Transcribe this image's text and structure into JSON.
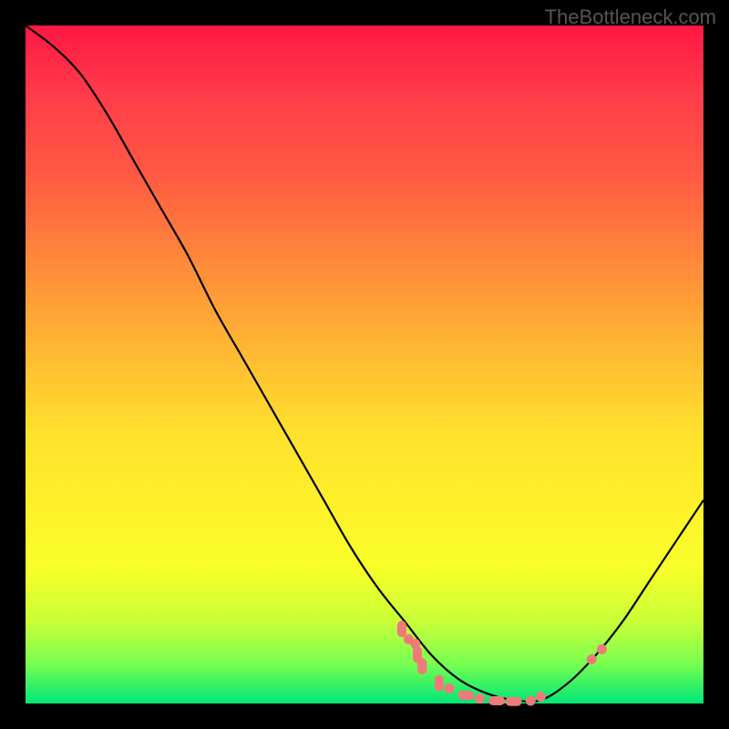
{
  "watermark": "TheBottleneck.com",
  "chart_data": {
    "type": "line",
    "title": "",
    "xlabel": "",
    "ylabel": "",
    "xlim": [
      0,
      1
    ],
    "ylim": [
      0,
      1
    ],
    "curve": {
      "name": "bottleneck-curve",
      "x": [
        0.0,
        0.04,
        0.08,
        0.12,
        0.16,
        0.2,
        0.24,
        0.28,
        0.32,
        0.36,
        0.4,
        0.44,
        0.48,
        0.52,
        0.56,
        0.6,
        0.64,
        0.68,
        0.72,
        0.76,
        0.8,
        0.84,
        0.88,
        0.92,
        0.96,
        1.0
      ],
      "y": [
        1.0,
        0.97,
        0.93,
        0.87,
        0.8,
        0.73,
        0.66,
        0.58,
        0.51,
        0.44,
        0.37,
        0.3,
        0.23,
        0.17,
        0.12,
        0.07,
        0.035,
        0.015,
        0.005,
        0.005,
        0.03,
        0.07,
        0.12,
        0.18,
        0.24,
        0.3
      ]
    },
    "highlight_points": [
      {
        "x": 0.555,
        "y": 0.11,
        "shape": "pill-v"
      },
      {
        "x": 0.565,
        "y": 0.095,
        "shape": "dot"
      },
      {
        "x": 0.575,
        "y": 0.088,
        "shape": "dot"
      },
      {
        "x": 0.578,
        "y": 0.072,
        "shape": "pill-v"
      },
      {
        "x": 0.585,
        "y": 0.055,
        "shape": "pill-v"
      },
      {
        "x": 0.61,
        "y": 0.03,
        "shape": "pill-v"
      },
      {
        "x": 0.625,
        "y": 0.022,
        "shape": "dot"
      },
      {
        "x": 0.65,
        "y": 0.012,
        "shape": "pill-h"
      },
      {
        "x": 0.67,
        "y": 0.007,
        "shape": "dot"
      },
      {
        "x": 0.695,
        "y": 0.004,
        "shape": "pill-h"
      },
      {
        "x": 0.72,
        "y": 0.003,
        "shape": "pill-h"
      },
      {
        "x": 0.745,
        "y": 0.004,
        "shape": "dot"
      },
      {
        "x": 0.76,
        "y": 0.01,
        "shape": "dot"
      },
      {
        "x": 0.835,
        "y": 0.065,
        "shape": "dot"
      },
      {
        "x": 0.85,
        "y": 0.08,
        "shape": "dot"
      }
    ],
    "gradient_meaning": "top-red-worse to bottom-green-better"
  }
}
